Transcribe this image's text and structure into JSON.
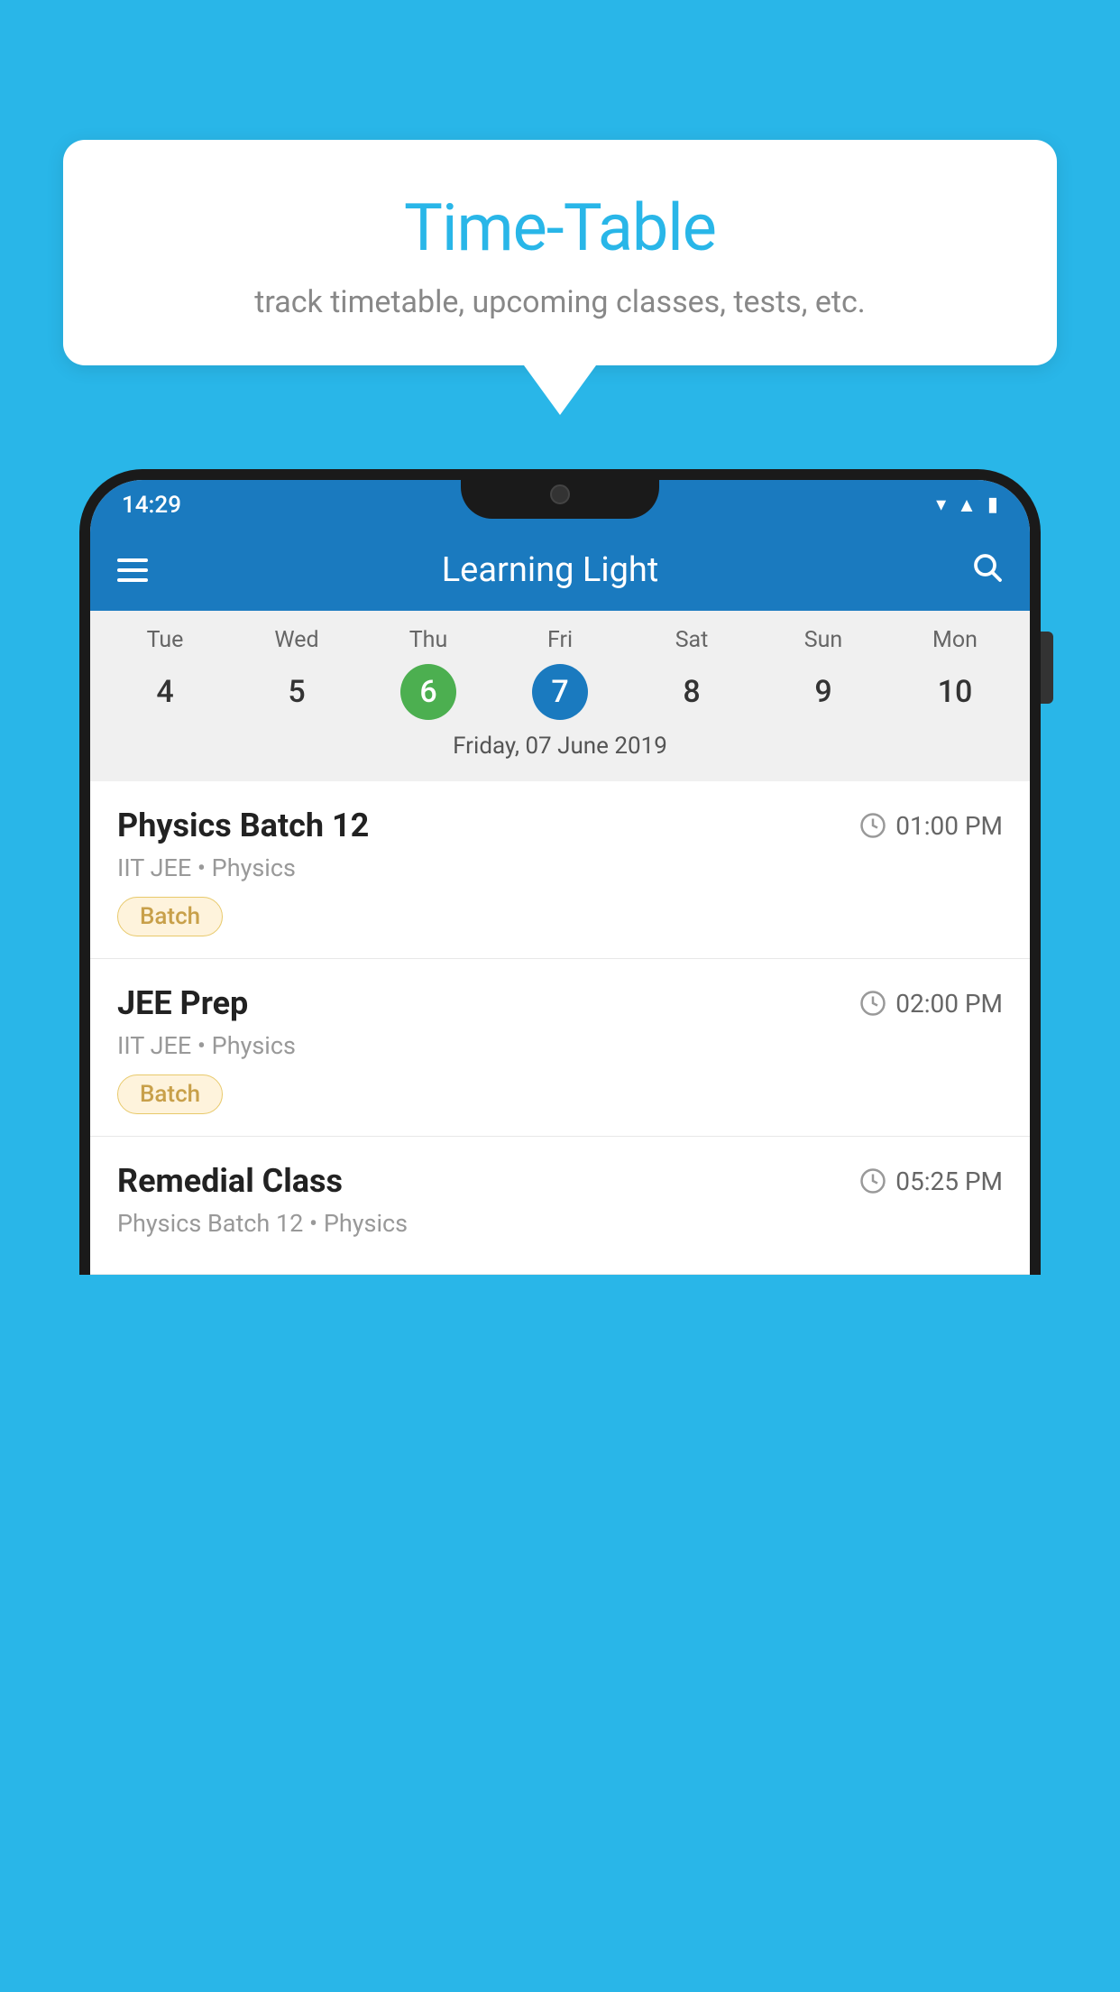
{
  "background_color": "#29b6e8",
  "speech_bubble": {
    "title": "Time-Table",
    "subtitle": "track timetable, upcoming classes, tests, etc."
  },
  "phone": {
    "status_bar": {
      "time": "14:29",
      "icons": [
        "wifi",
        "signal",
        "battery"
      ]
    },
    "app_bar": {
      "title": "Learning Light"
    },
    "calendar": {
      "days": [
        {
          "name": "Tue",
          "number": "4",
          "state": "normal"
        },
        {
          "name": "Wed",
          "number": "5",
          "state": "normal"
        },
        {
          "name": "Thu",
          "number": "6",
          "state": "today"
        },
        {
          "name": "Fri",
          "number": "7",
          "state": "selected"
        },
        {
          "name": "Sat",
          "number": "8",
          "state": "normal"
        },
        {
          "name": "Sun",
          "number": "9",
          "state": "normal"
        },
        {
          "name": "Mon",
          "number": "10",
          "state": "normal"
        }
      ],
      "selected_date_label": "Friday, 07 June 2019"
    },
    "schedule": [
      {
        "title": "Physics Batch 12",
        "time": "01:00 PM",
        "subtitle": "IIT JEE • Physics",
        "tag": "Batch"
      },
      {
        "title": "JEE Prep",
        "time": "02:00 PM",
        "subtitle": "IIT JEE • Physics",
        "tag": "Batch"
      },
      {
        "title": "Remedial Class",
        "time": "05:25 PM",
        "subtitle": "Physics Batch 12 • Physics",
        "tag": null
      }
    ]
  }
}
